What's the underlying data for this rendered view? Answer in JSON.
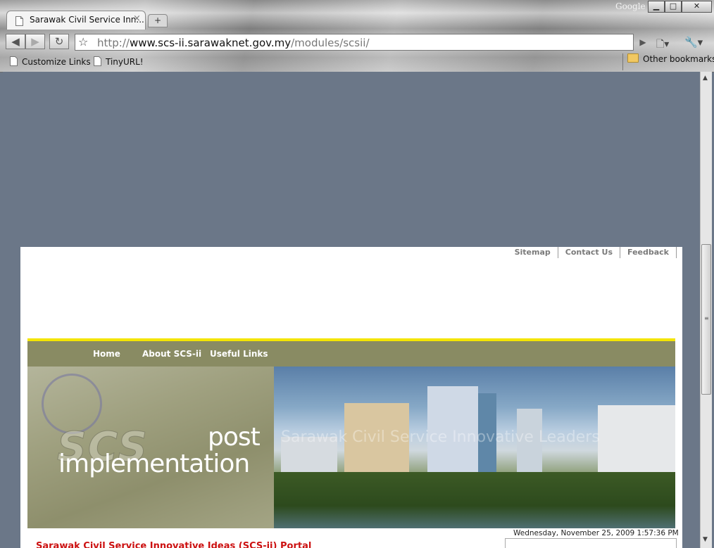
{
  "browser": {
    "tab_title": "Sarawak Civil Service Inn...",
    "google_label": "Google",
    "url": {
      "scheme": "http://",
      "host": "www.scs-ii.sarawaknet.gov.my",
      "path": "/modules/scsii/"
    },
    "bookmarks": [
      {
        "label": "Customize Links",
        "icon": "page-icon"
      },
      {
        "label": "TinyURL!",
        "icon": "page-icon"
      }
    ],
    "other_bookmarks": "Other bookmarks"
  },
  "page": {
    "util_links": [
      "Sitemap",
      "Contact Us",
      "Feedback"
    ],
    "menu": [
      "Home",
      "About SCS-ii",
      "Useful Links"
    ],
    "banner": {
      "logo": "SCS",
      "line1": "post",
      "line2": "implementation",
      "faded_caption": "Sarawak Civil Service Innovative Leaders"
    },
    "datetime": "Wednesday, November 25, 2009 1:57:36 PM",
    "portal_title": "Sarawak Civil Service Innovative Ideas (SCS-ii) Portal"
  },
  "colors": {
    "background": "#6b7788",
    "menu_bar": "#898b63",
    "accent_bar": "#f4e500",
    "title_red": "#cc1111"
  }
}
